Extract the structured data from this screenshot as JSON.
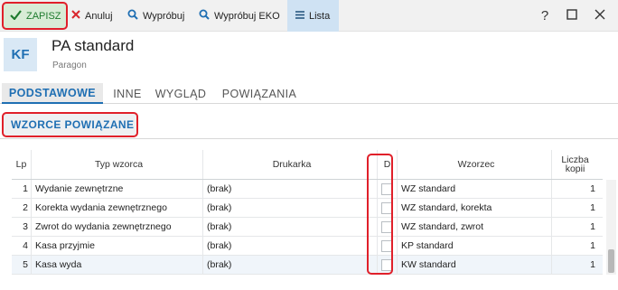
{
  "toolbar": {
    "save_label": "ZAPISZ",
    "cancel_label": "Anuluj",
    "test_label": "Wypróbuj",
    "test_eko_label": "Wypróbuj EKO",
    "list_label": "Lista",
    "help_label": "?"
  },
  "header": {
    "badge": "KF",
    "title": "PA standard",
    "subtitle": "Paragon"
  },
  "tabs": [
    {
      "label": "PODSTAWOWE",
      "active": true
    },
    {
      "label": "INNE",
      "active": false
    },
    {
      "label": "WYGLĄD",
      "active": false
    },
    {
      "label": "POWIĄZANIA",
      "active": false
    }
  ],
  "section": {
    "title": "WZORCE POWIĄZANE"
  },
  "table": {
    "columns": {
      "lp": "Lp",
      "typ": "Typ wzorca",
      "drukarka": "Drukarka",
      "d": "D",
      "wzorzec": "Wzorzec",
      "liczba_1": "Liczba",
      "liczba_2": "kopii"
    },
    "rows": [
      {
        "lp": "1",
        "typ": "Wydanie zewnętrzne",
        "drukarka": "(brak)",
        "d": false,
        "wzorzec": "WZ standard",
        "kopie": "1"
      },
      {
        "lp": "2",
        "typ": "Korekta wydania zewnętrznego",
        "drukarka": "(brak)",
        "d": false,
        "wzorzec": "WZ standard, korekta",
        "kopie": "1"
      },
      {
        "lp": "3",
        "typ": "Zwrot do wydania zewnętrznego",
        "drukarka": "(brak)",
        "d": false,
        "wzorzec": "WZ standard, zwrot",
        "kopie": "1"
      },
      {
        "lp": "4",
        "typ": "Kasa przyjmie",
        "drukarka": "(brak)",
        "d": false,
        "wzorzec": "KP standard",
        "kopie": "1"
      },
      {
        "lp": "5",
        "typ": "Kasa wyda",
        "drukarka": "(brak)",
        "d": false,
        "wzorzec": "KW standard",
        "kopie": "1"
      }
    ]
  },
  "colors": {
    "accent": "#1f6fb3",
    "highlight_border": "#e0202a",
    "save_text": "#1e7b2e",
    "save_bg": "#d8ecd6",
    "list_bg": "#cfe2f3",
    "cancel_icon": "#d9262c"
  },
  "icons": {
    "save": "check-icon",
    "cancel": "x-icon",
    "test": "magnifier-icon",
    "list": "hamburger-icon",
    "help": "question-icon",
    "maximize": "square-icon",
    "close": "close-icon"
  }
}
